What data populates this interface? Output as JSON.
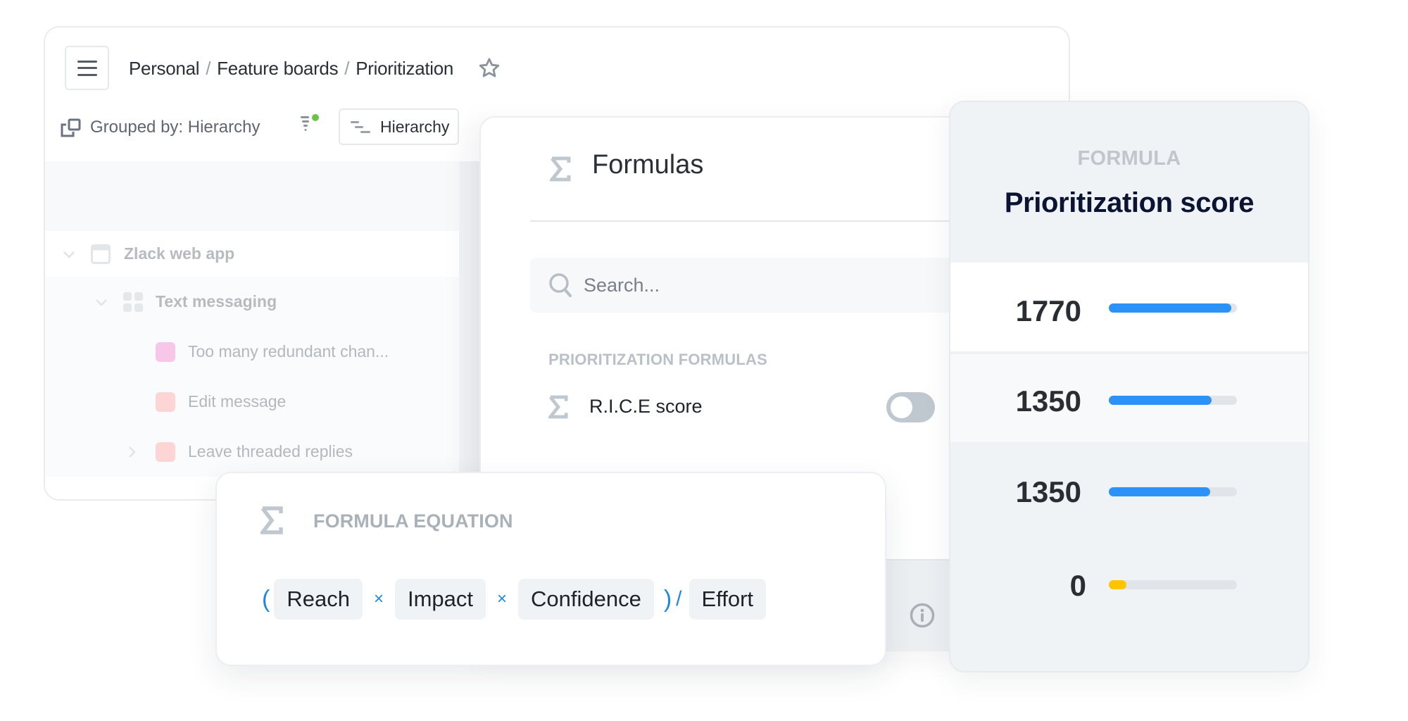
{
  "header": {
    "breadcrumb": [
      "Personal",
      "Feature boards",
      "Prioritization"
    ],
    "separator": "/",
    "menu_icon": "hamburger-icon",
    "favorite_icon": "star-icon"
  },
  "toolbar": {
    "grouped_by_label": "Grouped by: Hierarchy",
    "filter_indicator_color": "#6cc24a",
    "hierarchy_button_label": "Hierarchy"
  },
  "tree": {
    "items": [
      {
        "label": "Zlack web app",
        "level": 0,
        "type": "product",
        "expanded": true
      },
      {
        "label": "Text messaging",
        "level": 1,
        "type": "component",
        "expanded": true
      },
      {
        "label": "Too many redundant chan...",
        "level": 2,
        "type": "feature",
        "color": "#f8c6e8"
      },
      {
        "label": "Edit message",
        "level": 2,
        "type": "feature",
        "color": "#fdd5d5"
      },
      {
        "label": "Leave threaded replies",
        "level": 2,
        "type": "feature",
        "color": "#fdd5d5",
        "has_children": true
      }
    ]
  },
  "formulas_panel": {
    "title": "Formulas",
    "search_placeholder": "Search...",
    "search_value": "",
    "section_label": "PRIORITIZATION FORMULAS",
    "formulas": [
      {
        "label": "R.I.C.E score",
        "enabled": false
      }
    ],
    "footer_icon": "info-icon"
  },
  "score_card": {
    "kicker": "FORMULA",
    "title": "Prioritization score",
    "rows": [
      {
        "value": "1770",
        "fraction": 0.955,
        "color": "#2b93f7"
      },
      {
        "value": "1350",
        "fraction": 0.8,
        "color": "#2b93f7"
      },
      {
        "value": "1350",
        "fraction": 0.79,
        "color": "#2b93f7"
      },
      {
        "value": "0",
        "fraction": 0.14,
        "color": "#ffc400"
      }
    ]
  },
  "equation_card": {
    "label": "FORMULA EQUATION",
    "open_paren": "(",
    "close_paren": ")",
    "times": "×",
    "divide": "/",
    "terms": [
      "Reach",
      "Impact",
      "Confidence",
      "Effort"
    ]
  },
  "colors": {
    "accent_blue": "#1e88e5",
    "bar_blue": "#2b93f7",
    "bar_yellow": "#ffc400",
    "title_navy": "#0b1533"
  }
}
